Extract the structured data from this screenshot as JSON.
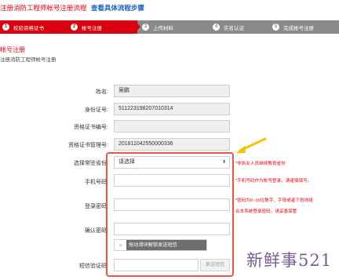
{
  "header": {
    "title": "注册消防工程师帐号注册流程",
    "link": "查看具体流程步骤"
  },
  "steps": [
    {
      "num": "1",
      "label": "校验资格证书"
    },
    {
      "num": "2",
      "label": "帐号注册"
    },
    {
      "num": "3",
      "label": "上传材料"
    },
    {
      "num": "4",
      "label": "实名认证"
    },
    {
      "num": "5",
      "label": "完成帐号注册"
    }
  ],
  "section": {
    "title": "帐号注册",
    "subtitle": "注册消防工程师帐号注册"
  },
  "form": {
    "name_label": "姓名:",
    "name_value": "吴鹏",
    "id_label": "身份证号:",
    "id_value": "511223198207010314",
    "cert_label": "资格证书编号:",
    "cert_value": "",
    "mgmt_label": "资格证书管理号:",
    "mgmt_value": "201811042550000336",
    "province_label": "选择常驻省份:",
    "province_value": "请选择",
    "phone_label": "手机号码:",
    "password_label": "登录密码:",
    "confirm_label": "确认密码:",
    "slider_text": "拖动滑块解锁发送短信",
    "slider_knob": "»",
    "sms_label": "短信验证码:",
    "sms_button": "发送短信"
  },
  "notes": {
    "province": "*非执业人员继续教育省份",
    "phone": "*手机号码作为帐号登录，请谨慎填写。",
    "password_1": "*密码为6~16位数字、字母或者下划线组",
    "password_2": "合本系统登录密码，请妥善保管"
  },
  "watermark": "新鲜事521",
  "colors": {
    "accent_red": "#e60012",
    "link_blue": "#1d5fbf",
    "highlight_border": "#e8563f",
    "arrow_yellow": "#f5c400"
  }
}
